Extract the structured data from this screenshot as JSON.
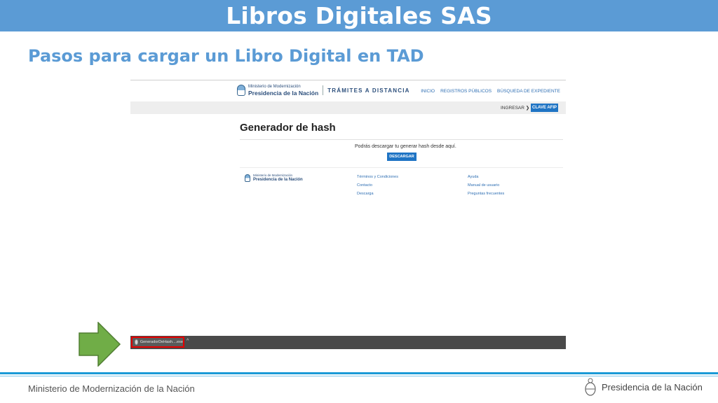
{
  "slide": {
    "title": "Libros Digitales SAS",
    "subtitle": "Pasos para cargar un Libro Digital en TAD"
  },
  "site": {
    "logo_small": "Ministerio de Modernización",
    "logo_big": "Presidencia de la Nación",
    "service": "TRÁMITES A DISTANCIA",
    "nav": [
      "INICIO",
      "REGISTROS PÚBLICOS",
      "BÚSQUEDA DE EXPEDIENTE"
    ],
    "ingresar": "INGRESAR ❯",
    "clave_afip": "CLAVE AFIP",
    "page_title": "Generador de hash",
    "message": "Podrás descargar tu generar hash desde aquí.",
    "download_button": "DESCARGAR",
    "footer_col1": [
      "Términos y Condiciones",
      "Contacto",
      "Descarga"
    ],
    "footer_col2": [
      "Ayuda",
      "Manual de usuario",
      "Preguntas frecuentes"
    ]
  },
  "download_bar": {
    "file_name": "GeneradorDeHash....exe",
    "caret": "^"
  },
  "colors": {
    "title_bar": "#5b9bd5",
    "subtitle": "#5b9bd5",
    "arrow_fill": "#70ad47",
    "arrow_stroke": "#507e32",
    "highlight": "#e60000",
    "footer_line": "#1a9ad6"
  },
  "footer": {
    "left": "Ministerio de Modernización de la Nación",
    "right": "Presidencia de la Nación"
  }
}
